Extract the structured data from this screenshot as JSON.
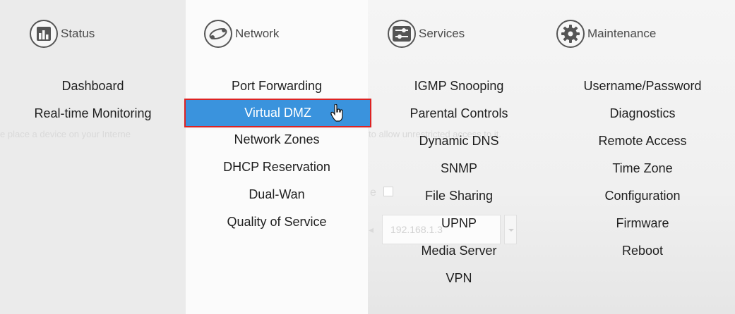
{
  "background": {
    "intro_left": "e place a device on your Interne",
    "intro_right": "to allow unrestricted access to it.",
    "checkbox_label_tail": "e",
    "ip_arrow": "◂",
    "ip_value": "192.168.1.3"
  },
  "menus": {
    "status": {
      "label": "Status",
      "icon": "bar-chart-icon",
      "items": [
        "Dashboard",
        "Real-time Monitoring"
      ]
    },
    "network": {
      "label": "Network",
      "icon": "globe-orbit-icon",
      "items": [
        "Port Forwarding",
        "Virtual DMZ",
        "Network Zones",
        "DHCP Reservation",
        "Dual-Wan",
        "Quality of Service"
      ],
      "selected": "Virtual DMZ"
    },
    "services": {
      "label": "Services",
      "icon": "sliders-icon",
      "items": [
        "IGMP Snooping",
        "Parental Controls",
        "Dynamic DNS",
        "SNMP",
        "File Sharing",
        "UPNP",
        "Media Server",
        "VPN"
      ]
    },
    "maintenance": {
      "label": "Maintenance",
      "icon": "gear-icon",
      "items": [
        "Username/Password",
        "Diagnostics",
        "Remote Access",
        "Time Zone",
        "Configuration",
        "Firmware",
        "Reboot"
      ]
    }
  },
  "colors": {
    "selected_bg": "#3a93dd",
    "selected_outline": "#dd2222",
    "icon_stroke": "#555555"
  }
}
